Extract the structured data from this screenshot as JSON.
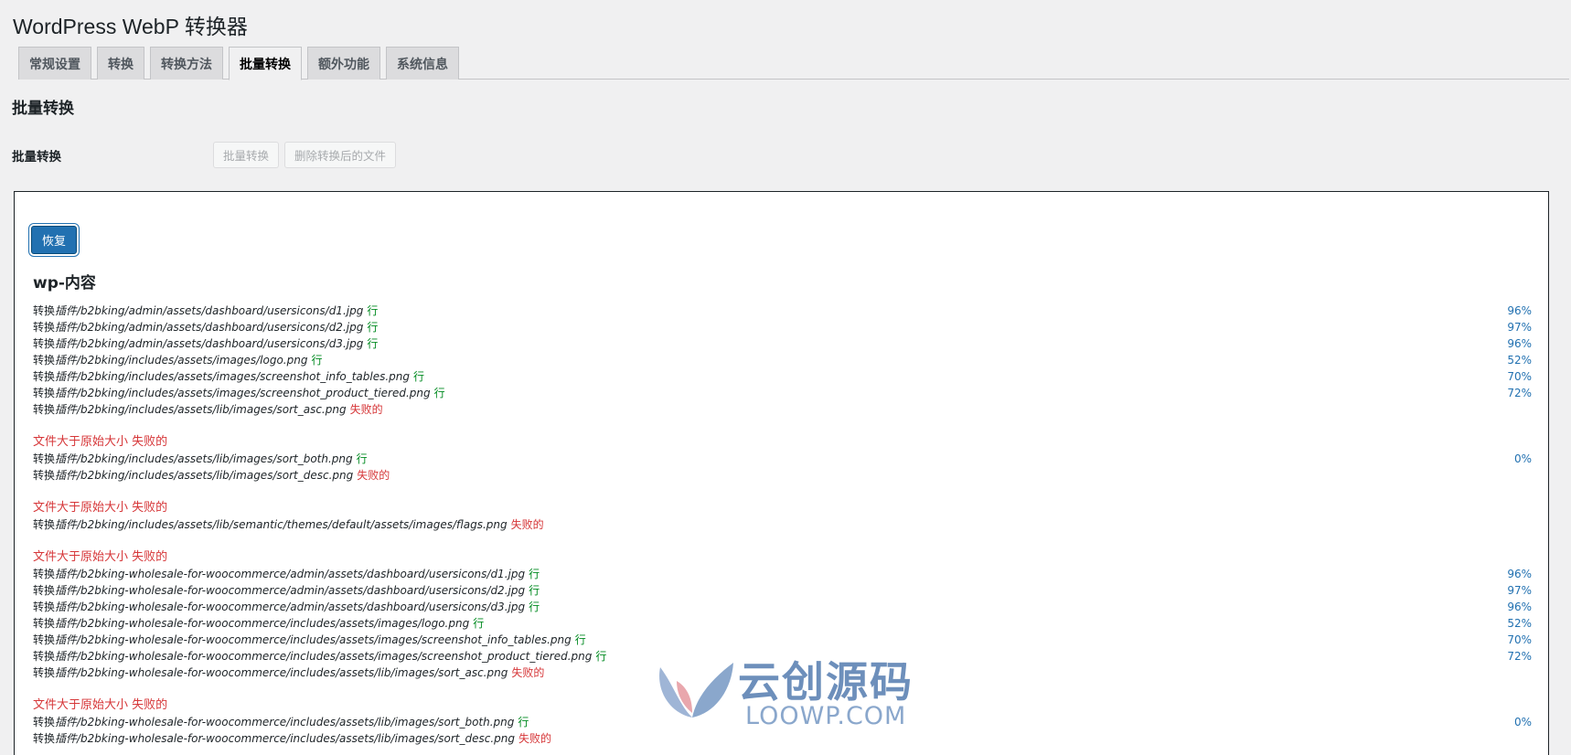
{
  "page_title": "WordPress WebP 转换器",
  "tabs": [
    {
      "label": "常规设置",
      "active": false
    },
    {
      "label": "转换",
      "active": false
    },
    {
      "label": "转换方法",
      "active": false
    },
    {
      "label": "批量转换",
      "active": true
    },
    {
      "label": "额外功能",
      "active": false
    },
    {
      "label": "系统信息",
      "active": false
    }
  ],
  "section_title": "批量转换",
  "bulk_row": {
    "label": "批量转换",
    "convert_button": "批量转换",
    "delete_button": "删除转换后的文件"
  },
  "panel": {
    "restore_button": "恢复",
    "heading": "wp-内容",
    "prefix": "转换",
    "size_error": "文件大于原始大小 失败的",
    "lines": [
      {
        "path": "插件/b2bking/admin/assets/dashboard/usersicons/d1.jpg",
        "status": "行",
        "ok": true,
        "pct": "96%"
      },
      {
        "path": "插件/b2bking/admin/assets/dashboard/usersicons/d2.jpg",
        "status": "行",
        "ok": true,
        "pct": "97%"
      },
      {
        "path": "插件/b2bking/admin/assets/dashboard/usersicons/d3.jpg",
        "status": "行",
        "ok": true,
        "pct": "96%"
      },
      {
        "path": "插件/b2bking/includes/assets/images/logo.png",
        "status": "行",
        "ok": true,
        "pct": "52%"
      },
      {
        "path": "插件/b2bking/includes/assets/images/screenshot_info_tables.png",
        "status": "行",
        "ok": true,
        "pct": "70%"
      },
      {
        "path": "插件/b2bking/includes/assets/images/screenshot_product_tiered.png",
        "status": "行",
        "ok": true,
        "pct": "72%"
      },
      {
        "path": "插件/b2bking/includes/assets/lib/images/sort_asc.png",
        "status": "失败的",
        "ok": false,
        "pct": ""
      },
      {
        "path": "插件/b2bking/includes/assets/lib/images/sort_both.png",
        "status": "行",
        "ok": true,
        "pct": "0%"
      },
      {
        "path": "插件/b2bking/includes/assets/lib/images/sort_desc.png",
        "status": "失败的",
        "ok": false,
        "pct": ""
      },
      {
        "path": "插件/b2bking/includes/assets/lib/semantic/themes/default/assets/images/flags.png",
        "status": "失败的",
        "ok": false,
        "pct": ""
      },
      {
        "path": "插件/b2bking-wholesale-for-woocommerce/admin/assets/dashboard/usersicons/d1.jpg",
        "status": "行",
        "ok": true,
        "pct": "96%"
      },
      {
        "path": "插件/b2bking-wholesale-for-woocommerce/admin/assets/dashboard/usersicons/d2.jpg",
        "status": "行",
        "ok": true,
        "pct": "97%"
      },
      {
        "path": "插件/b2bking-wholesale-for-woocommerce/admin/assets/dashboard/usersicons/d3.jpg",
        "status": "行",
        "ok": true,
        "pct": "96%"
      },
      {
        "path": "插件/b2bking-wholesale-for-woocommerce/includes/assets/images/logo.png",
        "status": "行",
        "ok": true,
        "pct": "52%"
      },
      {
        "path": "插件/b2bking-wholesale-for-woocommerce/includes/assets/images/screenshot_info_tables.png",
        "status": "行",
        "ok": true,
        "pct": "70%"
      },
      {
        "path": "插件/b2bking-wholesale-for-woocommerce/includes/assets/images/screenshot_product_tiered.png",
        "status": "行",
        "ok": true,
        "pct": "72%"
      },
      {
        "path": "插件/b2bking-wholesale-for-woocommerce/includes/assets/lib/images/sort_asc.png",
        "status": "失败的",
        "ok": false,
        "pct": ""
      },
      {
        "path": "插件/b2bking-wholesale-for-woocommerce/includes/assets/lib/images/sort_both.png",
        "status": "行",
        "ok": true,
        "pct": "0%"
      },
      {
        "path": "插件/b2bking-wholesale-for-woocommerce/includes/assets/lib/images/sort_desc.png",
        "status": "失败的",
        "ok": false,
        "pct": ""
      }
    ]
  },
  "watermark": {
    "cn": "云创源码",
    "en": "LOOWP.COM"
  },
  "colors": {
    "ok": "#008a20",
    "fail": "#d63638",
    "percent": "#2271b1",
    "primary": "#2271b1"
  }
}
